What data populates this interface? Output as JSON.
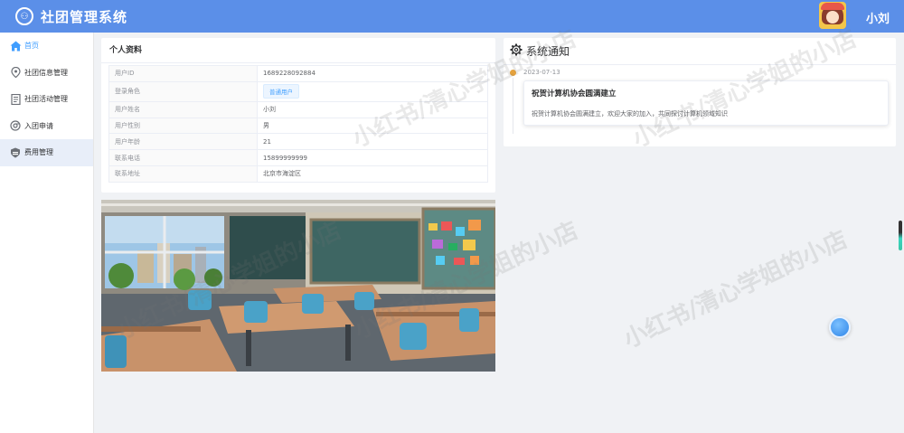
{
  "header": {
    "title": "社团管理系统",
    "username": "小刘"
  },
  "sidebar": {
    "items": [
      {
        "label": "首页",
        "icon": "home-icon"
      },
      {
        "label": "社团信息管理",
        "icon": "location-icon"
      },
      {
        "label": "社团活动管理",
        "icon": "document-icon"
      },
      {
        "label": "入团申请",
        "icon": "chrome-icon"
      },
      {
        "label": "费用管理",
        "icon": "shield-icon"
      }
    ]
  },
  "profile": {
    "title": "个人资料",
    "rows": [
      {
        "label": "用户ID",
        "value": "1689228092884"
      },
      {
        "label": "登录角色",
        "value": "普通用户"
      },
      {
        "label": "用户姓名",
        "value": "小刘"
      },
      {
        "label": "用户性别",
        "value": "男"
      },
      {
        "label": "用户年龄",
        "value": "21"
      },
      {
        "label": "联系电话",
        "value": "15899999999"
      },
      {
        "label": "联系地址",
        "value": "北京市海淀区"
      }
    ]
  },
  "notice": {
    "title": "系统通知",
    "items": [
      {
        "date": "2023-07-13",
        "title": "祝贺计算机协会圆满建立",
        "content": "祝贺计算机协会圆满建立，欢迎大家的加入，共同探讨计算机领域知识"
      }
    ]
  },
  "watermark": "小红书/清心学姐的小店",
  "colors": {
    "header": "#5b8fe8",
    "accent": "#409eff",
    "timeline_dot": "#e6a23c"
  }
}
